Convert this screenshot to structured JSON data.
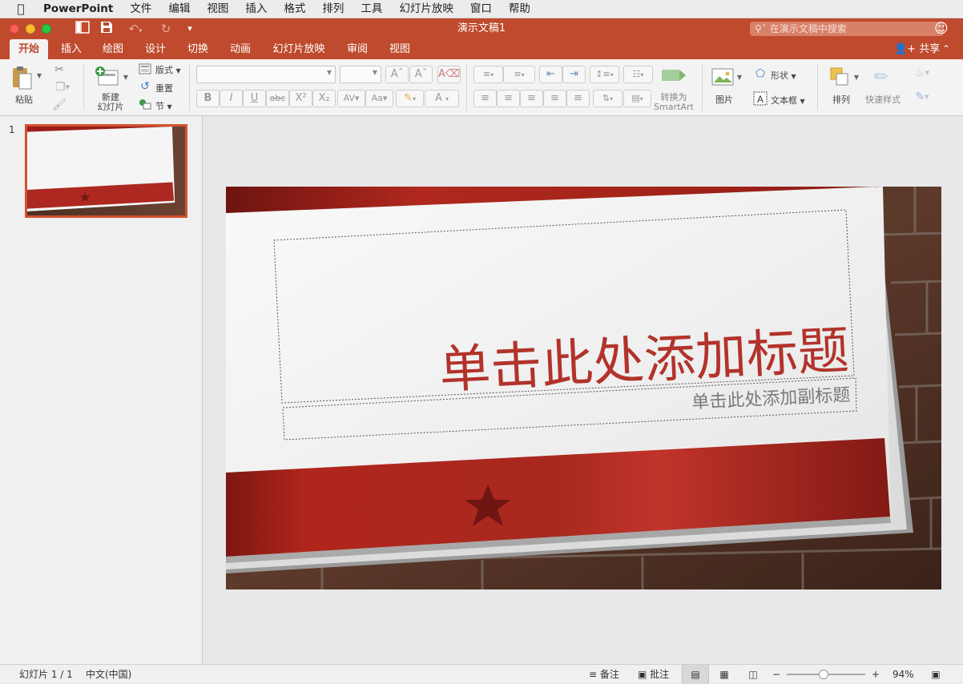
{
  "menubar": {
    "app": "PowerPoint",
    "items": [
      "文件",
      "编辑",
      "视图",
      "插入",
      "格式",
      "排列",
      "工具",
      "幻灯片放映",
      "窗口",
      "帮助"
    ]
  },
  "window": {
    "title": "演示文稿1",
    "search_placeholder": "在演示文稿中搜索"
  },
  "tabs": [
    "开始",
    "插入",
    "绘图",
    "设计",
    "切换",
    "动画",
    "幻灯片放映",
    "审阅",
    "视图"
  ],
  "active_tab": "开始",
  "share_label": "共享",
  "ribbon": {
    "paste": "粘贴",
    "new_slide_line1": "新建",
    "new_slide_line2": "幻灯片",
    "layout": "版式",
    "reset": "重置",
    "section": "节",
    "smartart_line1": "转换为",
    "smartart_line2": "SmartArt",
    "picture": "图片",
    "shapes": "形状",
    "textbox": "文本框",
    "arrange": "排列",
    "quick_styles": "快速样式",
    "font_name": "",
    "font_size": ""
  },
  "format_buttons": {
    "bold": "B",
    "italic": "I",
    "underline": "U",
    "strike": "abc",
    "superscript": "X²",
    "subscript": "X₂"
  },
  "thumbnail": {
    "number": "1"
  },
  "slide": {
    "title": "单击此处添加标题",
    "subtitle": "单击此处添加副标题"
  },
  "status": {
    "slide_counter": "幻灯片 1 / 1",
    "language": "中文(中国)",
    "notes": "备注",
    "comments": "批注",
    "zoom": "94%"
  },
  "colors": {
    "brand": "#bf4a2d",
    "slide_red": "#a82a22",
    "title_text": "#b2332b"
  }
}
